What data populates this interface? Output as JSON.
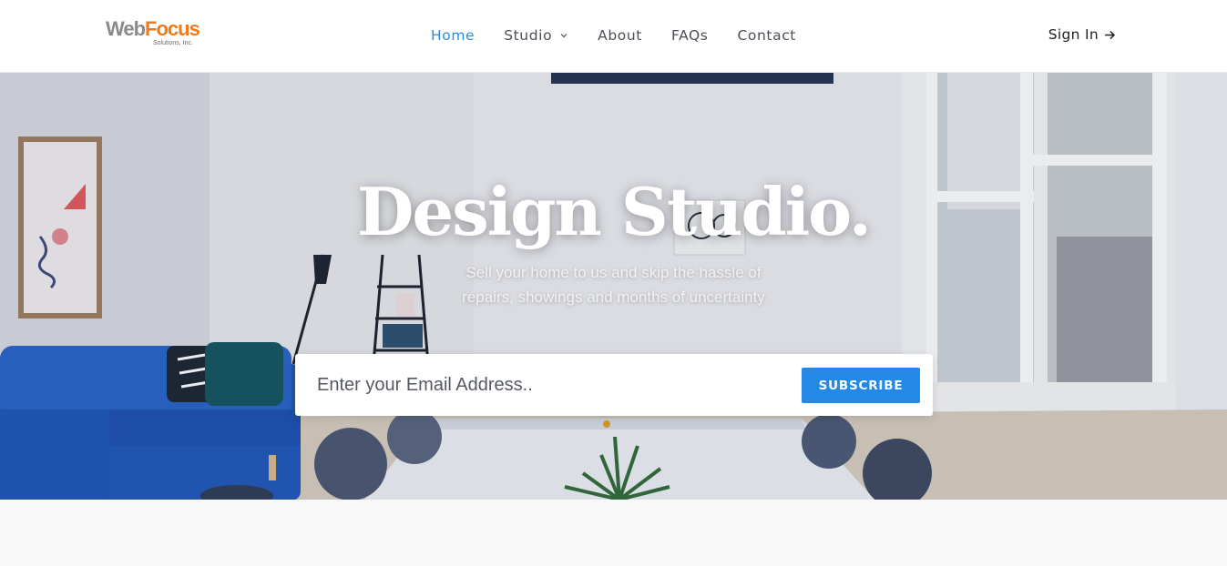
{
  "logo": {
    "primary": "Web",
    "accent": "Focus",
    "tagline": "Solutions, Inc."
  },
  "nav": {
    "items": [
      {
        "label": "Home",
        "active": true
      },
      {
        "label": "Studio",
        "dropdown": true
      },
      {
        "label": "About"
      },
      {
        "label": "FAQs"
      },
      {
        "label": "Contact"
      }
    ],
    "signin_label": "Sign In"
  },
  "hero": {
    "title": "Design Studio.",
    "subtitle_line1": "Sell your home to us and skip the hassle of",
    "subtitle_line2": "repairs, showings and months of uncertainty"
  },
  "subscribe": {
    "placeholder": "Enter your Email Address..",
    "button_label": "SUBSCRIBE"
  },
  "colors": {
    "accent": "#2389e6",
    "nav_active": "#2b8be0",
    "logo_accent": "#f07a1a"
  }
}
